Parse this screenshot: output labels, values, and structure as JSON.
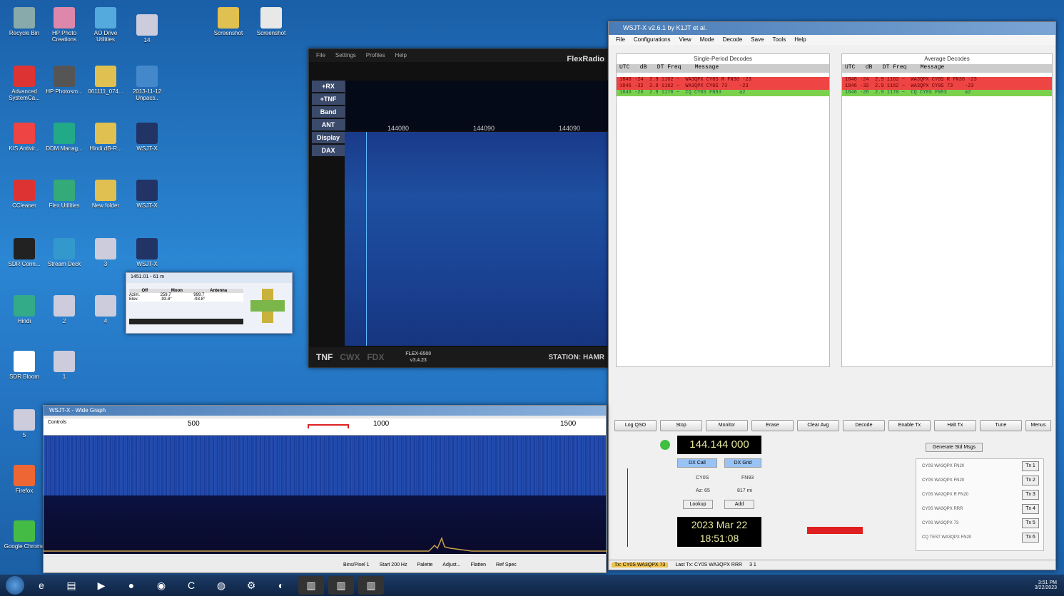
{
  "desktop_icons": [
    {
      "label": "Recycle Bin"
    },
    {
      "label": "HP Photo Creations"
    },
    {
      "label": "AO Drive Utilities"
    },
    {
      "label": "14"
    },
    {
      "label": "Screenshot"
    },
    {
      "label": "Screenshot"
    },
    {
      "label": "Advanced SystemCa..."
    },
    {
      "label": "HP Photosm..."
    },
    {
      "label": "061111_074..."
    },
    {
      "label": "2013-11-12 Unpacs.."
    },
    {
      "label": "KIS Antivir..."
    },
    {
      "label": "DDM Manag..."
    },
    {
      "label": "Hindi dB-R..."
    },
    {
      "label": "WSJT-X"
    },
    {
      "label": "CCleaner"
    },
    {
      "label": "Flex Utilities"
    },
    {
      "label": "New folder"
    },
    {
      "label": "WSJT-X"
    },
    {
      "label": "SDR Conn..."
    },
    {
      "label": "Stream Deck"
    },
    {
      "label": "3"
    },
    {
      "label": "WSJT-X"
    },
    {
      "label": "Hindi"
    },
    {
      "label": "2"
    },
    {
      "label": "4"
    },
    {
      "label": "SDR Bloom"
    },
    {
      "label": "1"
    },
    {
      "label": "5"
    },
    {
      "label": "Firefox"
    },
    {
      "label": "Google Chrome"
    }
  ],
  "flex": {
    "menu": [
      "File",
      "Settings",
      "Profiles",
      "Help"
    ],
    "logo": "FlexRadio",
    "side_buttons": [
      "+RX",
      "+TNF",
      "Band",
      "ANT",
      "Display",
      "DAX"
    ],
    "ticks": [
      "144080",
      "144090",
      "144090"
    ],
    "bar_labels": [
      "TNF",
      "CWX",
      "FDX"
    ],
    "model": "FLEX-6500",
    "version": "v3.4.23",
    "station": "STATION: HAMR"
  },
  "wsjt": {
    "title": "WSJT-X  v2.6.1  by K1JT et al.",
    "menu": [
      "File",
      "Configurations",
      "View",
      "Mode",
      "Decode",
      "Save",
      "Tools",
      "Help"
    ],
    "left_title": "Single-Period Decodes",
    "right_title": "Average Decodes",
    "header": "UTC   dB   DT Freq    Message",
    "decodes": [
      {
        "text": "1846 -24  2.9 1162 ~  WA3QPX CY0S R FN30 -23",
        "color": "red"
      },
      {
        "text": "1846 -32  2.9 1162 ~  WA3QPX CY0S 73    -23",
        "color": "red"
      },
      {
        "text": "1846 -26  2.9 1170 ~  CQ CY0S FN93      a2",
        "color": "green"
      }
    ],
    "buttons": [
      "Log QSO",
      "Stop",
      "Monitor",
      "Erase",
      "Clear Avg",
      "Decode",
      "Enable Tx",
      "Halt Tx",
      "Tune",
      "Menus"
    ],
    "frequency": "144.144 000",
    "clock_date": "2023 Mar 22",
    "clock_time": "18:51:08",
    "dx_call": "CY0S",
    "dx_grid": "FN93",
    "az": "Az: 65",
    "dist": "817 mi",
    "tx_lines": [
      {
        "label": "CY0S WA3QPX FN20",
        "btn": "Tx 1"
      },
      {
        "label": "CY0S WA3QPX FN20",
        "btn": "Tx 2"
      },
      {
        "label": "CY0S WA3QPX R FN20",
        "btn": "Tx 3"
      },
      {
        "label": "CY0S WA3QPX RRR",
        "btn": "Tx 4"
      },
      {
        "label": "CY0S WA3QPX 73",
        "btn": "Tx 5"
      },
      {
        "label": "CQ TEST WA3QPX FN20",
        "btn": "Tx 6"
      }
    ],
    "gen_btn": "Generate Std Msgs",
    "status": [
      "Tx: CY0S WA3QPX 73",
      "Last Tx: CY0S WA3QPX RRR",
      "3 1"
    ]
  },
  "wide": {
    "title": "WSJT-X - Wide Graph",
    "controls": "Controls",
    "ticks": [
      "500",
      "1000",
      "1500"
    ],
    "ctrl": [
      "Bins/Pixel 1",
      "Start 200 Hz",
      "Palette",
      "Adjust...",
      "Flatten",
      "Ref Spec"
    ]
  },
  "small": {
    "title": "1451.01 - 61 m",
    "headers": [
      "Off",
      "Moon",
      "Antenna"
    ],
    "rows": [
      [
        "Azim.",
        "259.7",
        "999.7"
      ],
      [
        "Elev.",
        "-93.8°",
        "-93.8°"
      ]
    ]
  },
  "tray": {
    "time": "3:51 PM",
    "date": "3/22/2023"
  }
}
